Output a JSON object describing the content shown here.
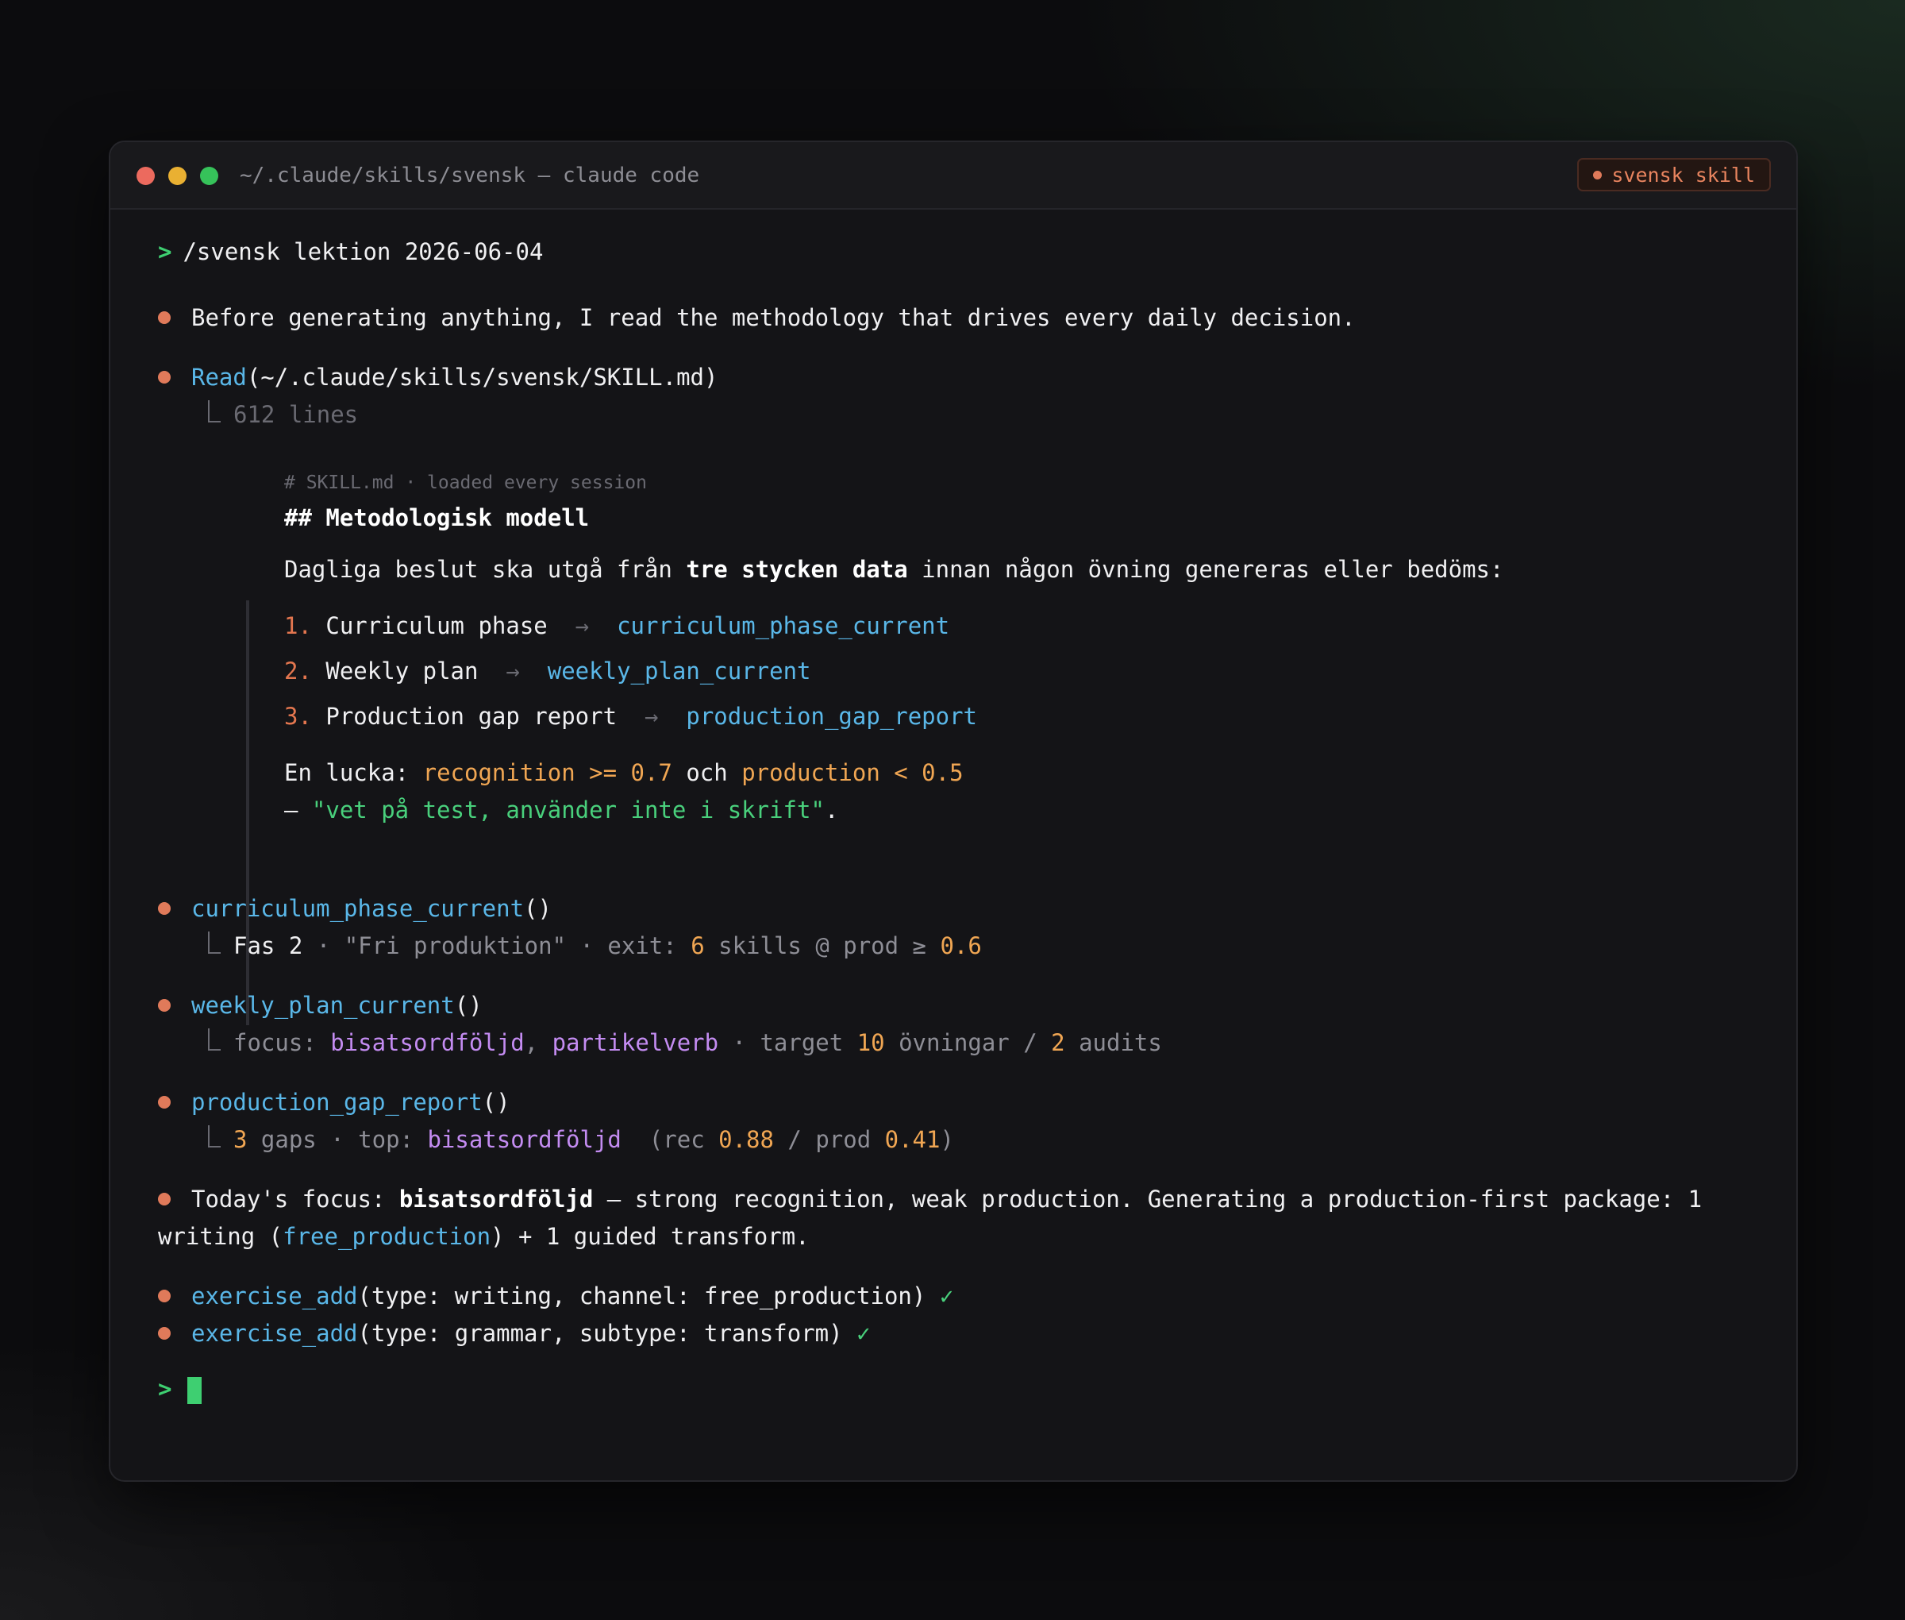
{
  "window": {
    "title": "~/.claude/skills/svensk — claude code",
    "badge": "svensk skill",
    "colors": {
      "accent": "#e07a5a",
      "prompt": "#3ecf71",
      "fn": "#5ab7e8"
    }
  },
  "command": {
    "prompt": ">",
    "text": "/svensk lektion 2026-06-04"
  },
  "intro": "Before generating anything, I read the methodology that drives every daily decision.",
  "read": {
    "fn": "Read",
    "arg": "(~/.claude/skills/svensk/SKILL.md)",
    "result": "612 lines"
  },
  "skill_doc": {
    "comment": "# SKILL.md · loaded every session",
    "heading": "## Metodologisk modell",
    "para_a": "Dagliga beslut ska utgå från ",
    "para_bold": "tre stycken data",
    "para_b": " innan någon övning genereras eller bedöms:",
    "arrow": "→",
    "items": [
      {
        "num": "1.",
        "label": "Curriculum phase",
        "tool": "curriculum_phase_current"
      },
      {
        "num": "2.",
        "label": "Weekly plan",
        "tool": "weekly_plan_current"
      },
      {
        "num": "3.",
        "label": "Production gap report",
        "tool": "production_gap_report"
      }
    ],
    "gap_label": "En lucka: ",
    "gap_cond1": "recognition >= 0.7",
    "gap_and": " och ",
    "gap_cond2": "production < 0.5",
    "gap_dash": "— ",
    "gap_quote": "\"vet på test, använder inte i skrift\"",
    "gap_end": "."
  },
  "calls": {
    "phase": {
      "fn": "curriculum_phase_current",
      "parens": "()",
      "r1": "Fas 2",
      "r2": " · \"Fri produktion\" · exit: ",
      "r3": "6",
      "r4": " skills @ prod ≥ ",
      "r5": "0.6"
    },
    "weekly": {
      "fn": "weekly_plan_current",
      "parens": "()",
      "r1": "focus: ",
      "r2": "bisatsordföljd",
      "r3": ", ",
      "r4": "partikelverb",
      "r5": " · target ",
      "r6": "10",
      "r7": " övningar / ",
      "r8": "2",
      "r9": " audits"
    },
    "gap": {
      "fn": "production_gap_report",
      "parens": "()",
      "r1": "3",
      "r2": " gaps · top: ",
      "r3": "bisatsordföljd",
      "r4": "  (rec ",
      "r5": "0.88",
      "r6": " / prod ",
      "r7": "0.41",
      "r8": ")"
    }
  },
  "focus": {
    "a": "Today's focus: ",
    "b": "bisatsordföljd",
    "c": " — strong recognition, weak production. Generating a production-first package: 1",
    "d": "writing (",
    "e": "free_production",
    "f": ") + 1 guided transform."
  },
  "adds": [
    {
      "fn": "exercise_add",
      "args": "(type: writing, channel: free_production)",
      "check": "✓"
    },
    {
      "fn": "exercise_add",
      "args": "(type: grammar, subtype: transform)",
      "check": "✓"
    }
  ],
  "final_prompt": ">"
}
